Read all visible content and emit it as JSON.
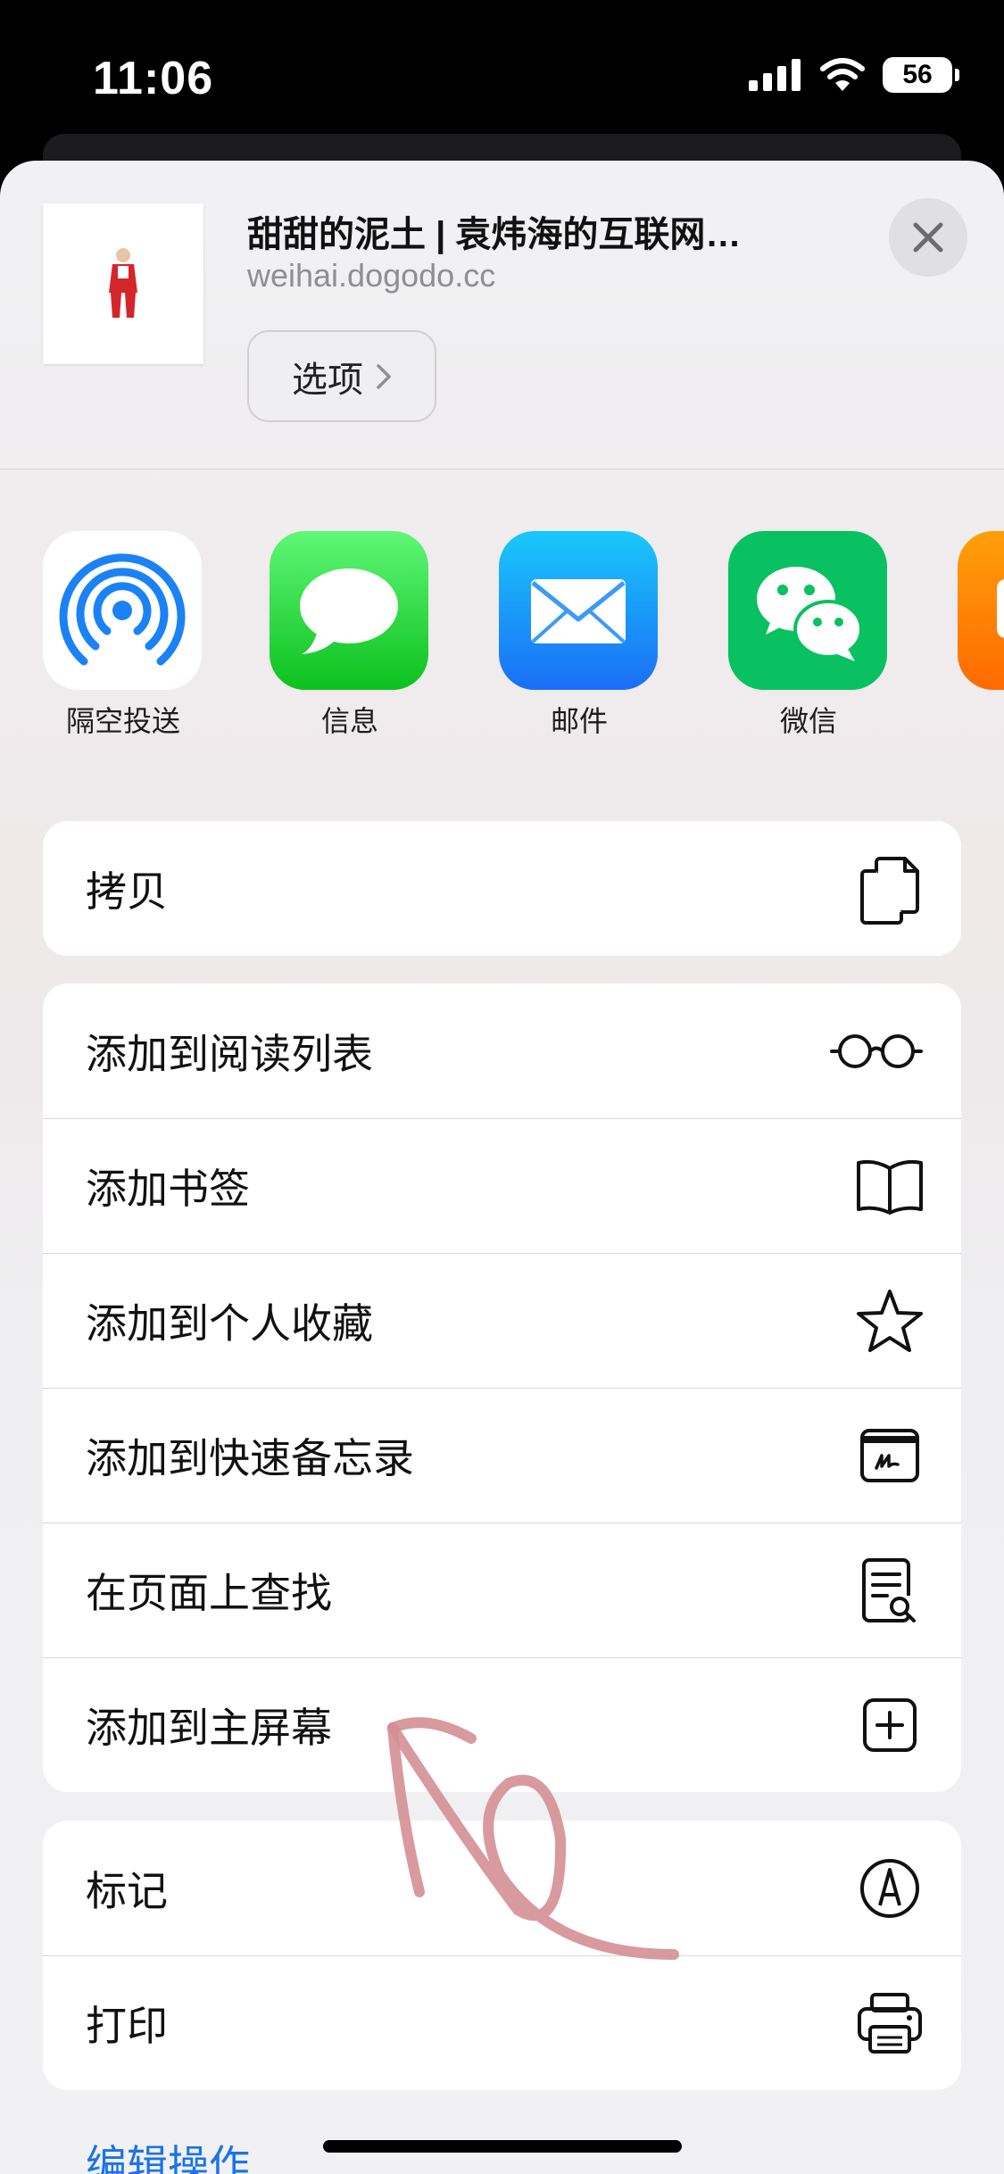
{
  "status_bar": {
    "time": "11:06",
    "battery": "56"
  },
  "header": {
    "title": "甜甜的泥土 | 袁炜海的互联网…",
    "url": "weihai.dogodo.cc",
    "options_label": "选项"
  },
  "share_apps": [
    {
      "label": "隔空投送",
      "icon": "airdrop-icon"
    },
    {
      "label": "信息",
      "icon": "messages-icon"
    },
    {
      "label": "邮件",
      "icon": "mail-icon"
    },
    {
      "label": "微信",
      "icon": "wechat-icon"
    }
  ],
  "actions": {
    "copy": {
      "label": "拷贝",
      "icon": "copy-icon"
    },
    "main": [
      {
        "label": "添加到阅读列表",
        "icon": "glasses-icon"
      },
      {
        "label": "添加书签",
        "icon": "book-icon"
      },
      {
        "label": "添加到个人收藏",
        "icon": "star-icon"
      },
      {
        "label": "添加到快速备忘录",
        "icon": "quick-note-icon"
      },
      {
        "label": "在页面上查找",
        "icon": "find-on-page-icon"
      },
      {
        "label": "添加到主屏幕",
        "icon": "add-square-icon"
      }
    ],
    "other": [
      {
        "label": "标记",
        "icon": "markup-icon"
      },
      {
        "label": "打印",
        "icon": "printer-icon"
      }
    ]
  },
  "edit_actions_label": "编辑操作...",
  "colors": {
    "accent": "#1a73e8",
    "annotation": "#d48f93"
  }
}
